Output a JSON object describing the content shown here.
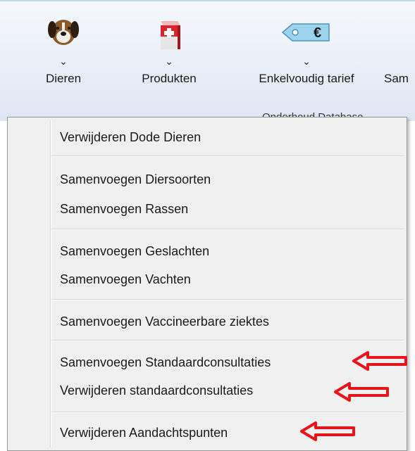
{
  "ribbon": {
    "buttons": [
      {
        "label": "Dieren"
      },
      {
        "label": "Produkten"
      },
      {
        "label": "Enkelvoudig tarief"
      },
      {
        "label": "Sam"
      }
    ],
    "chevron": "⌄",
    "group_label": "Onderhoud Database",
    "price_tag_symbol": "€"
  },
  "menu": {
    "items": [
      {
        "label": "Verwijderen Dode Dieren"
      },
      {
        "label": "Samenvoegen Diersoorten"
      },
      {
        "label": "Samenvoegen Rassen"
      },
      {
        "label": "Samenvoegen Geslachten"
      },
      {
        "label": "Samenvoegen Vachten"
      },
      {
        "label": "Samenvoegen Vaccineerbare ziektes"
      },
      {
        "label": "Samenvoegen Standaardconsultaties"
      },
      {
        "label": "Verwijderen standaardconsultaties"
      },
      {
        "label": "Verwijderen Aandachtspunten"
      }
    ]
  },
  "annotation_color": "#e8141b",
  "icons": [
    "dog-icon",
    "medical-kit-icon",
    "price-tag-icon"
  ]
}
